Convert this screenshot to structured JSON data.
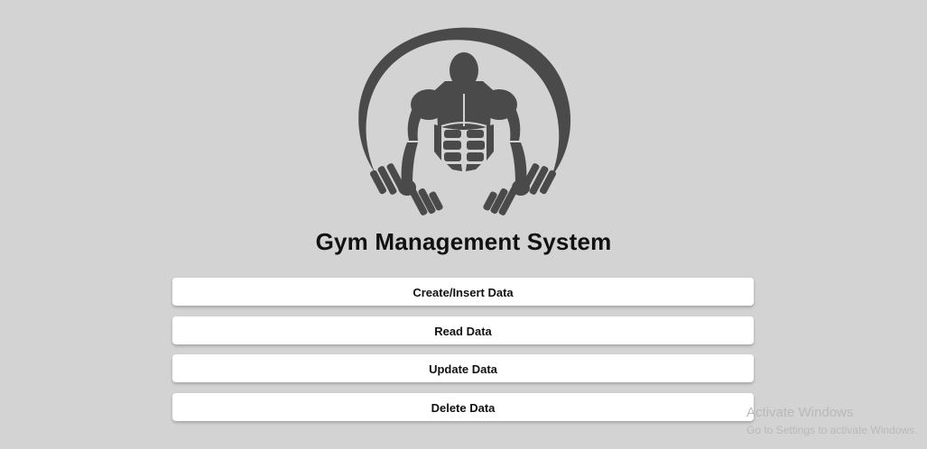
{
  "app": {
    "title": "Gym Management System",
    "logo_icon": "bodybuilder-dumbbells-icon"
  },
  "menu": {
    "buttons": [
      {
        "label": "Create/Insert Data"
      },
      {
        "label": "Read Data"
      },
      {
        "label": "Update Data"
      },
      {
        "label": "Delete Data"
      }
    ]
  },
  "watermark": {
    "title": "Activate Windows",
    "subtitle": "Go to Settings to activate Windows."
  },
  "colors": {
    "background": "#d3d3d3",
    "logo": "#4a4a4a",
    "button_bg": "#ffffff",
    "text": "#111111"
  }
}
